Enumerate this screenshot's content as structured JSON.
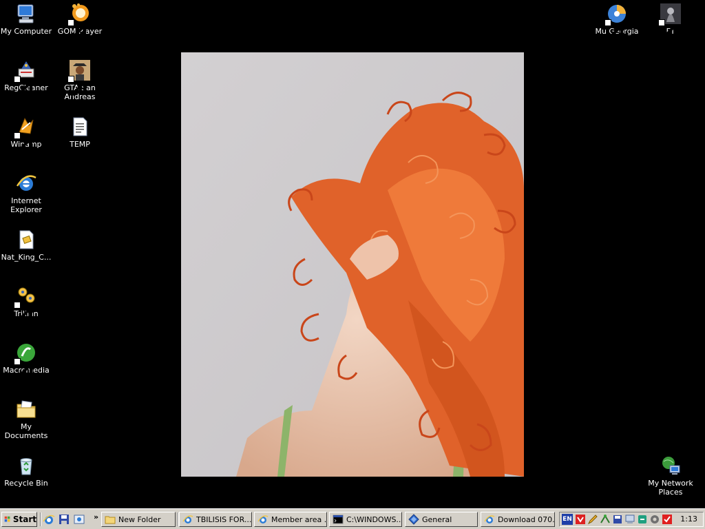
{
  "desktop": {
    "icons": [
      {
        "name": "my-computer",
        "label": "My Computer"
      },
      {
        "name": "gom-player",
        "label": "GOM Player"
      },
      {
        "name": "regcleaner",
        "label": "RegCleaner"
      },
      {
        "name": "gta-san-andreas",
        "label": "GTA San Andreas"
      },
      {
        "name": "winamp",
        "label": "Winamp"
      },
      {
        "name": "temp",
        "label": "TEMP"
      },
      {
        "name": "internet-explorer",
        "label": "Internet Explorer"
      },
      {
        "name": "nat-king",
        "label": "Nat_King_C..."
      },
      {
        "name": "trillian",
        "label": "Trillian"
      },
      {
        "name": "macromedia",
        "label": "Macromedia"
      },
      {
        "name": "my-documents",
        "label": "My Documents"
      },
      {
        "name": "recycle-bin",
        "label": "Recycle Bin"
      },
      {
        "name": "mu-georgia",
        "label": "Mu Georgia"
      },
      {
        "name": "ft",
        "label": "FT"
      },
      {
        "name": "my-network-places",
        "label": "My Network Places"
      }
    ]
  },
  "taskbar": {
    "start_label": "Start",
    "buttons": [
      {
        "label": "New Folder",
        "icon": "folder-icon"
      },
      {
        "label": "TBILISIS FOR...",
        "icon": "ie-icon"
      },
      {
        "label": "Member area ...",
        "icon": "ie-icon"
      },
      {
        "label": "C:\\WINDOWS...",
        "icon": "cmd-icon"
      },
      {
        "label": "General",
        "icon": "diamond-icon"
      },
      {
        "label": "Download 070...",
        "icon": "ie-icon"
      }
    ],
    "tray": {
      "language": "EN",
      "clock": "1:13"
    }
  },
  "colors": {
    "taskbar_bg": "#d4d0c8",
    "desktop_bg": "#000000",
    "hair": "#e0622a"
  }
}
